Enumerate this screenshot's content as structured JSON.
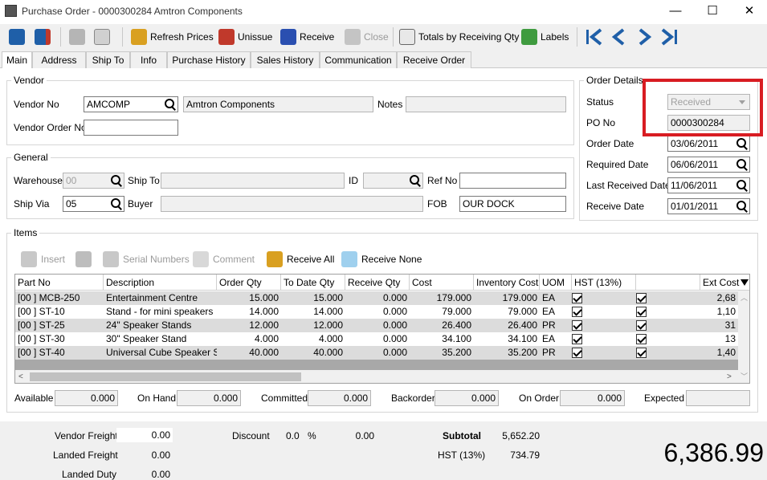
{
  "window": {
    "title": "Purchase Order - 0000300284 Amtron Components",
    "minimize": "—",
    "maximize": "☐",
    "close": "✕"
  },
  "toolbar": {
    "refresh_prices": "Refresh Prices",
    "unissue": "Unissue",
    "receive": "Receive",
    "close": "Close",
    "totals_by_receiving_qty": "Totals by Receiving Qty",
    "labels": "Labels"
  },
  "tabs": [
    "Main",
    "Address",
    "Ship To",
    "Info",
    "Purchase History",
    "Sales History",
    "Communication",
    "Receive Order"
  ],
  "vendor": {
    "legend": "Vendor",
    "vendor_no_label": "Vendor No",
    "vendor_no": "AMCOMP",
    "vendor_name": "Amtron Components",
    "notes_label": "Notes",
    "notes": "",
    "vendor_order_no_label": "Vendor Order No",
    "vendor_order_no": ""
  },
  "general": {
    "legend": "General",
    "warehouse_label": "Warehouse",
    "warehouse": "00",
    "ship_to_label": "Ship To",
    "ship_to": "",
    "id_label": "ID",
    "id": "",
    "ref_no_label": "Ref No",
    "ref_no": "",
    "ship_via_label": "Ship Via",
    "ship_via": "05",
    "buyer_label": "Buyer",
    "buyer": "",
    "fob_label": "FOB",
    "fob": "OUR DOCK"
  },
  "order_details": {
    "legend": "Order Details",
    "status_label": "Status",
    "status": "Received",
    "po_no_label": "PO No",
    "po_no": "0000300284",
    "order_date_label": "Order Date",
    "order_date": "03/06/2011",
    "required_date_label": "Required Date",
    "required_date": "06/06/2011",
    "last_received_date_label": "Last Received Date",
    "last_received_date": "11/06/2011",
    "receive_date_label": "Receive Date",
    "receive_date": "01/01/2011"
  },
  "items": {
    "legend": "Items",
    "toolbar": {
      "insert": "Insert",
      "serial_numbers": "Serial Numbers",
      "comment": "Comment",
      "receive_all": "Receive All",
      "receive_none": "Receive None"
    },
    "columns": [
      "Part No",
      "Description",
      "Order Qty",
      "To Date Qty",
      "Receive Qty",
      "Cost",
      "Inventory Cost",
      "UOM",
      "HST (13%)",
      "",
      "Ext Cost"
    ],
    "rows": [
      {
        "part_no": "[00   ] MCB-250",
        "description": "Entertainment Centre",
        "order_qty": "15.000",
        "to_date_qty": "15.000",
        "receive_qty": "0.000",
        "cost": "179.000",
        "inventory_cost": "179.000",
        "uom": "EA",
        "hst": true,
        "col2": true,
        "ext_cost": "2,68"
      },
      {
        "part_no": "[00   ] ST-10",
        "description": "Stand - for mini speakers",
        "order_qty": "14.000",
        "to_date_qty": "14.000",
        "receive_qty": "0.000",
        "cost": "79.000",
        "inventory_cost": "79.000",
        "uom": "EA",
        "hst": true,
        "col2": true,
        "ext_cost": "1,10"
      },
      {
        "part_no": "[00   ] ST-25",
        "description": "24\" Speaker Stands",
        "order_qty": "12.000",
        "to_date_qty": "12.000",
        "receive_qty": "0.000",
        "cost": "26.400",
        "inventory_cost": "26.400",
        "uom": "PR",
        "hst": true,
        "col2": true,
        "ext_cost": "31"
      },
      {
        "part_no": "[00   ] ST-30",
        "description": "30\" Speaker Stand",
        "order_qty": "4.000",
        "to_date_qty": "4.000",
        "receive_qty": "0.000",
        "cost": "34.100",
        "inventory_cost": "34.100",
        "uom": "EA",
        "hst": true,
        "col2": true,
        "ext_cost": "13"
      },
      {
        "part_no": "[00   ] ST-40",
        "description": "Universal Cube Speaker Sta",
        "order_qty": "40.000",
        "to_date_qty": "40.000",
        "receive_qty": "0.000",
        "cost": "35.200",
        "inventory_cost": "35.200",
        "uom": "PR",
        "hst": true,
        "col2": true,
        "ext_cost": "1,40"
      }
    ]
  },
  "stock": {
    "available_label": "Available",
    "available": "0.000",
    "on_hand_label": "On Hand",
    "on_hand": "0.000",
    "committed_label": "Committed",
    "committed": "0.000",
    "backorder_label": "Backorder",
    "backorder": "0.000",
    "on_order_label": "On Order",
    "on_order": "0.000",
    "expected_label": "Expected",
    "expected": ""
  },
  "totals": {
    "vendor_freight_label": "Vendor Freight",
    "vendor_freight": "0.00",
    "landed_freight_label": "Landed Freight",
    "landed_freight": "0.00",
    "landed_duty_label": "Landed Duty",
    "landed_duty": "0.00",
    "discount_label": "Discount",
    "discount_pct": "0.0",
    "pct_sign": "%",
    "discount_amt": "0.00",
    "subtotal_label": "Subtotal",
    "subtotal": "5,652.20",
    "hst_label": "HST (13%)",
    "hst": "734.79",
    "grand_total": "6,386.99"
  }
}
